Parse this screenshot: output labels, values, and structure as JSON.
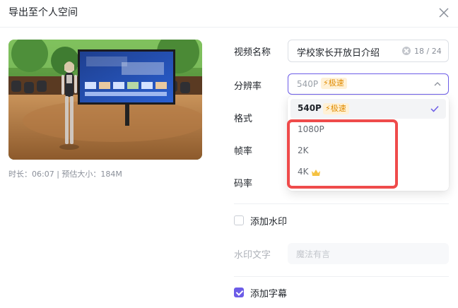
{
  "dialog": {
    "title": "导出至个人空间",
    "close_icon": "close-icon"
  },
  "preview": {
    "duration_label": "时长：",
    "duration": "06:07",
    "separator": " | ",
    "size_label": "预估大小：",
    "size": "184M"
  },
  "form": {
    "video_name": {
      "label": "视频名称",
      "value": "学校家长开放日介绍",
      "count": "18 / 24"
    },
    "resolution": {
      "label": "分辨率",
      "value": "540P",
      "badge": "极速",
      "options": [
        {
          "label": "540P",
          "badge": "极速",
          "selected": true
        },
        {
          "label": "1080P"
        },
        {
          "label": "2K"
        },
        {
          "label": "4K",
          "icon": "crown-icon"
        }
      ]
    },
    "format": {
      "label": "格式"
    },
    "frame_rate": {
      "label": "帧率"
    },
    "bitrate": {
      "label": "码率"
    },
    "watermark": {
      "label": "添加水印",
      "checked": false
    },
    "watermark_text": {
      "label": "水印文字",
      "placeholder": "魔法有言"
    },
    "subtitles": {
      "label": "添加字幕",
      "checked": true
    }
  },
  "colors": {
    "accent": "#6c5ce7",
    "badge_bg": "#fff1d6",
    "badge_text": "#e08b00",
    "highlight": "#ef4b4b"
  }
}
